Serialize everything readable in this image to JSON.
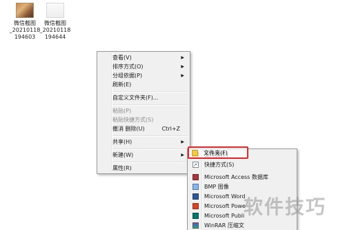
{
  "desktop": {
    "icons": [
      {
        "line1": "微信截图",
        "line2": "_20210118",
        "line3": "194603",
        "icon": "image-thumbnail-icon"
      },
      {
        "line1": "微信截图",
        "line2": "_20210118",
        "line3": "194644",
        "icon": "image-thumbnail-icon"
      }
    ]
  },
  "context_menu": {
    "items": [
      {
        "label": "查看(V)",
        "arrow": "▶"
      },
      {
        "label": "排序方式(O)",
        "arrow": "▶"
      },
      {
        "label": "分组依据(P)",
        "arrow": "▶"
      },
      {
        "label": "刷新(E)"
      },
      {
        "label": "自定义文件夹(F)..."
      },
      {
        "label": "粘贴(P)",
        "disabled": true
      },
      {
        "label": "粘贴快捷方式(S)",
        "disabled": true
      },
      {
        "label": "撤消 删除(U)",
        "shortcut": "Ctrl+Z"
      },
      {
        "label": "共享(H)",
        "arrow": "▶"
      },
      {
        "label": "新建(W)",
        "arrow": "▶"
      },
      {
        "label": "属性(R)"
      }
    ]
  },
  "new_submenu": {
    "items": [
      {
        "label": "文件夹(F)",
        "icon": "folder-icon"
      },
      {
        "label": "快捷方式(S)",
        "icon": "shortcut-icon"
      },
      {
        "label": "Microsoft Access 数据库",
        "icon": "access-icon"
      },
      {
        "label": "BMP 图像",
        "icon": "bmp-icon"
      },
      {
        "label": "Microsoft Word",
        "icon": "word-icon"
      },
      {
        "label": "Microsoft Powe",
        "icon": "powerpoint-icon"
      },
      {
        "label": "Microsoft Publi",
        "icon": "publisher-icon"
      },
      {
        "label": "WinRAR 压缩文",
        "icon": "winrar-icon"
      }
    ]
  },
  "watermark": {
    "text": "软件技巧"
  },
  "colors": {
    "highlight": "#e0252b",
    "menu_bg": "#f0f0f0",
    "menu_border": "#979797"
  }
}
